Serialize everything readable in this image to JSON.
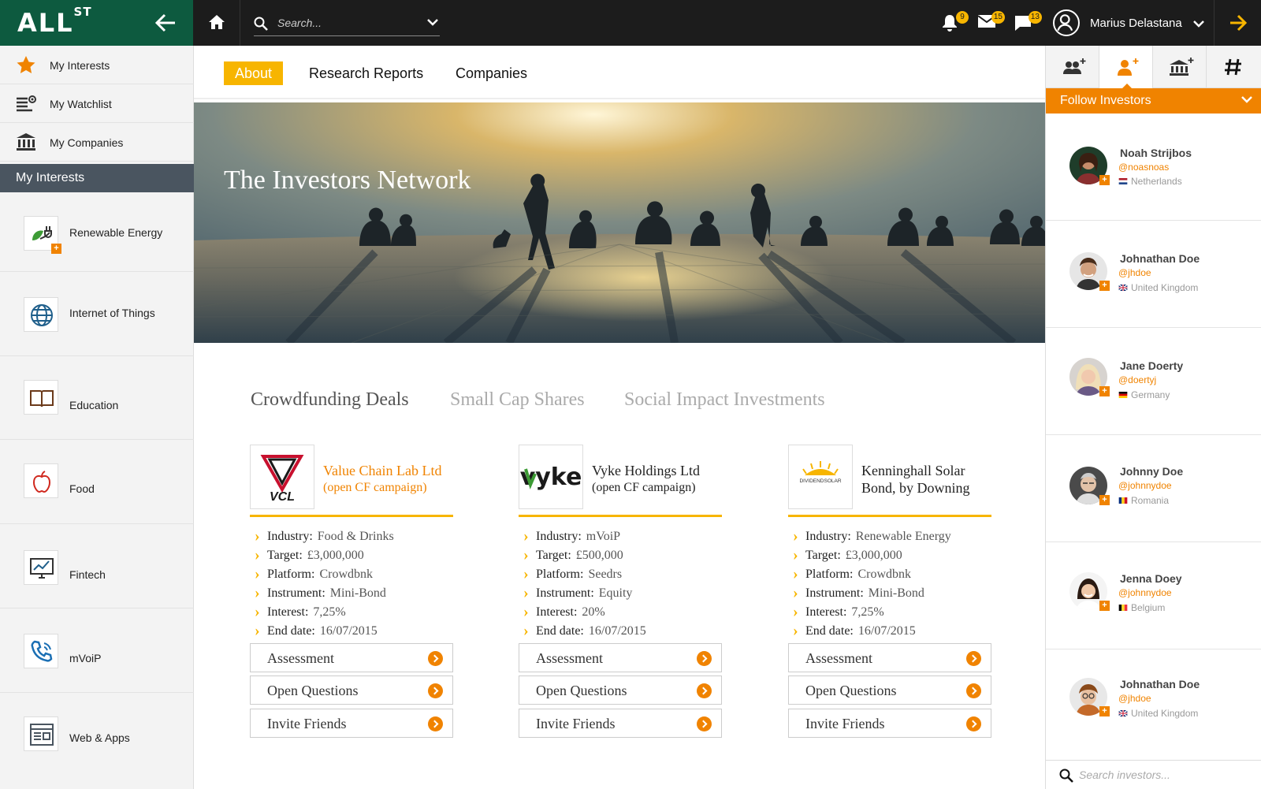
{
  "brand": {
    "logo_main": "ALL",
    "logo_sup": "ST"
  },
  "topbar": {
    "search_placeholder": "Search...",
    "notifications_count": "9",
    "messages_count": "15",
    "chat_count": "13",
    "user_name": "Marius Delastana"
  },
  "sidebar": {
    "nav": [
      {
        "label": "My Interests",
        "icon": "star-icon"
      },
      {
        "label": "My Watchlist",
        "icon": "watchlist-icon"
      },
      {
        "label": "My Companies",
        "icon": "bank-icon"
      }
    ],
    "section_title": "My Interests",
    "interests": [
      {
        "label": "Renewable Energy",
        "icon": "plug-leaf-icon"
      },
      {
        "label": "Internet of Things",
        "icon": "globe-icon"
      },
      {
        "label": "Education",
        "icon": "book-icon"
      },
      {
        "label": "Food",
        "icon": "apple-icon"
      },
      {
        "label": "Fintech",
        "icon": "chart-monitor-icon"
      },
      {
        "label": "mVoiP",
        "icon": "phone-icon"
      },
      {
        "label": "Web & Apps",
        "icon": "browser-icon"
      }
    ]
  },
  "main": {
    "tabs": [
      "About",
      "Research Reports",
      "Companies"
    ],
    "hero_title": "The Investors Network",
    "categories": [
      "Crowdfunding Deals",
      "Small Cap Shares",
      "Social Impact Investments"
    ],
    "fact_labels": {
      "industry": "Industry:",
      "target": "Target:",
      "platform": "Platform:",
      "instrument": "Instrument:",
      "interest": "Interest:",
      "end_date": "End date:"
    },
    "buttons": [
      "Assessment",
      "Open Questions",
      "Invite Friends"
    ],
    "deals": [
      {
        "name": "Value Chain Lab Ltd",
        "sub": "(open CF campaign)",
        "logo_text": "VCL",
        "industry": "Food & Drinks",
        "target": "£3,000,000",
        "platform": "Crowdbnk",
        "instrument": "Mini-Bond",
        "interest": "7,25%",
        "end_date": "16/07/2015"
      },
      {
        "name": "Vyke Holdings Ltd",
        "sub": "(open CF campaign)",
        "logo_text": "vyke",
        "industry": "mVoiP",
        "target": "£500,000",
        "platform": "Seedrs",
        "instrument": "Equity",
        "interest": "20%",
        "end_date": "16/07/2015"
      },
      {
        "name": "Kenninghall Solar",
        "sub": "Bond, by Downing",
        "logo_text": "DIVIDENDSOLAR",
        "industry": "Renewable Energy",
        "target": "£3,000,000",
        "platform": "Crowdbnk",
        "instrument": "Mini-Bond",
        "interest": "7,25%",
        "end_date": "16/07/2015"
      }
    ]
  },
  "right": {
    "header": "Follow Investors",
    "tab_icons": [
      "group-add-icon",
      "person-add-icon",
      "bank-add-icon",
      "hashtag-icon"
    ],
    "investors": [
      {
        "name": "Noah Strijbos",
        "handle": "@noasnoas",
        "country": "Netherlands"
      },
      {
        "name": "Johnathan Doe",
        "handle": "@jhdoe",
        "country": "United Kingdom"
      },
      {
        "name": "Jane Doerty",
        "handle": "@doertyj",
        "country": "Germany"
      },
      {
        "name": "Johnny Doe",
        "handle": "@johnnydoe",
        "country": "Romania"
      },
      {
        "name": "Jenna Doey",
        "handle": "@johnnydoe",
        "country": "Belgium"
      },
      {
        "name": "Johnathan Doe",
        "handle": "@jhdoe",
        "country": "United Kingdom"
      }
    ],
    "search_placeholder": "Search investors..."
  },
  "colors": {
    "brand_green": "#0d5a3f",
    "accent_orange": "#f08300",
    "accent_yellow": "#f7b500",
    "topbar": "#1c1c1c"
  }
}
